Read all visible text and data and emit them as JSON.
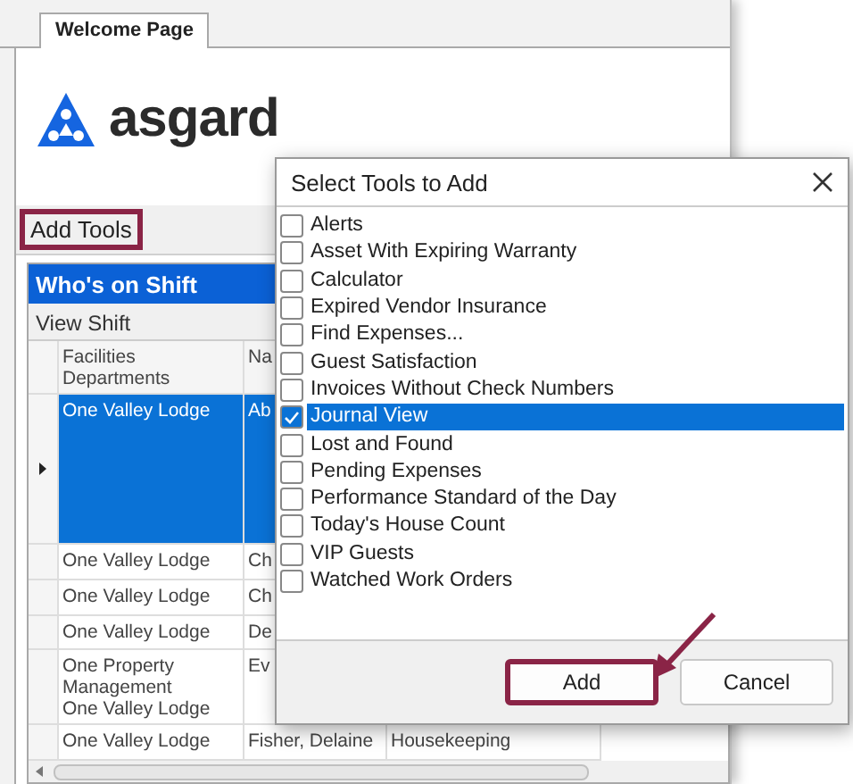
{
  "tab": {
    "label": "Welcome Page",
    "selected": true
  },
  "logo": {
    "text": "asgard"
  },
  "toolbar": {
    "button": "Add Tools",
    "highlighted": true
  },
  "panel": {
    "title": "Who's on Shift",
    "subheader": "View Shift"
  },
  "grid": {
    "columns": [
      "Facilities Departments",
      "Na"
    ],
    "rows": [
      {
        "cells": [
          "One Valley Lodge",
          "Ab"
        ],
        "selected": true
      },
      {
        "cells": [
          "One Valley Lodge",
          "Ch"
        ],
        "selected": false
      },
      {
        "cells": [
          "One Valley Lodge",
          "Ch"
        ],
        "selected": false
      },
      {
        "cells": [
          "One Valley Lodge",
          "De"
        ],
        "selected": false
      },
      {
        "cells": [
          "One Property\nManagement\nOne Valley Lodge",
          "Ev"
        ],
        "selected": false
      },
      {
        "cells": [
          "One Valley Lodge",
          "Fisher, Delaine",
          "Housekeeping"
        ],
        "selected": false
      }
    ]
  },
  "dialog": {
    "title": "Select Tools to Add",
    "items": [
      {
        "label": "Alerts",
        "checked": false,
        "selected": false
      },
      {
        "label": "Asset With Expiring Warranty",
        "checked": false,
        "selected": false
      },
      {
        "label": "Calculator",
        "checked": false,
        "selected": false
      },
      {
        "label": "Expired Vendor Insurance",
        "checked": false,
        "selected": false
      },
      {
        "label": "Find Expenses...",
        "checked": false,
        "selected": false
      },
      {
        "label": "Guest Satisfaction",
        "checked": false,
        "selected": false
      },
      {
        "label": "Invoices Without Check Numbers",
        "checked": false,
        "selected": false
      },
      {
        "label": "Journal View",
        "checked": true,
        "selected": true
      },
      {
        "label": "Lost and Found",
        "checked": false,
        "selected": false
      },
      {
        "label": "Pending Expenses",
        "checked": false,
        "selected": false
      },
      {
        "label": "Performance Standard of the Day",
        "checked": false,
        "selected": false
      },
      {
        "label": "Today's House Count",
        "checked": false,
        "selected": false
      },
      {
        "label": "VIP Guests",
        "checked": false,
        "selected": false
      },
      {
        "label": "Watched Work Orders",
        "checked": false,
        "selected": false
      }
    ],
    "buttons": [
      {
        "label": "Add",
        "highlighted": true
      },
      {
        "label": "Cancel",
        "highlighted": false
      }
    ]
  }
}
